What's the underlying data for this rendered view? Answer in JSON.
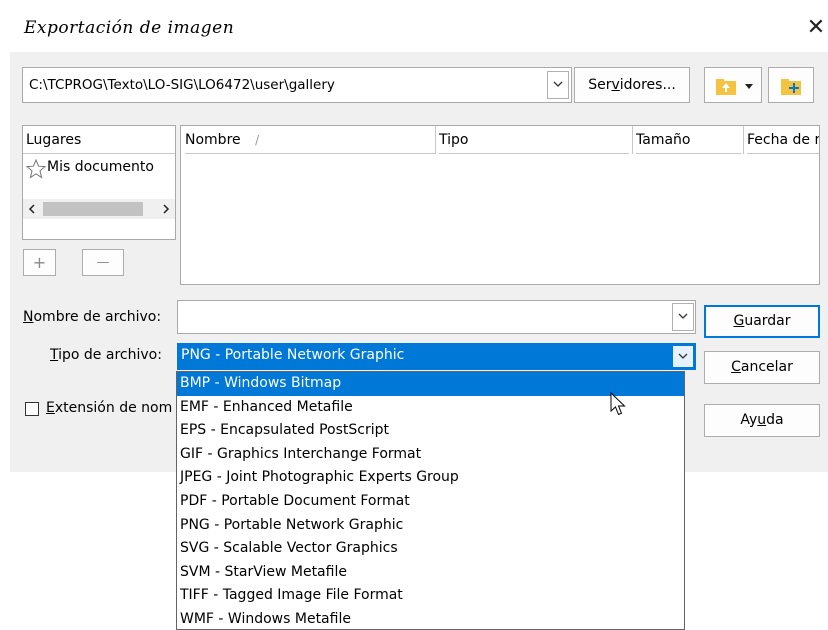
{
  "window": {
    "title": "Exportación de imagen",
    "close_glyph": "✕"
  },
  "toolbar": {
    "path_value": "C:\\TCPROG\\Texto\\LO-SIG\\LO6472\\user\\gallery",
    "servers_label_pre": "Ser",
    "servers_label_key": "v",
    "servers_label_post": "idores...",
    "up_folder_icon": "folder-up-icon",
    "new_folder_icon": "new-folder-icon",
    "folder_color": "#f5c342",
    "accent_color": "#0078d7"
  },
  "places": {
    "header": "Lugares",
    "items": [
      {
        "label": "Mis documento",
        "icon": "star-icon"
      }
    ],
    "add_label": "+",
    "remove_label": "—"
  },
  "files": {
    "columns": [
      "Nombre",
      "Tipo",
      "Tamaño",
      "Fecha de r"
    ],
    "sort_glyph": "/"
  },
  "form": {
    "filename_label_key": "N",
    "filename_label_post": "ombre de archivo:",
    "filename_value": "",
    "filetype_label_key": "T",
    "filetype_label_post": "ipo de archivo:",
    "filetype_value": "PNG - Portable Network Graphic",
    "extension_label_key": "E",
    "extension_label_post": "xtensión de nom",
    "extension_checked": false
  },
  "buttons": {
    "save_key": "G",
    "save_post": "uardar",
    "cancel_key": "C",
    "cancel_post": "ancelar",
    "help_pre": "Ay",
    "help_key": "u",
    "help_post": "da"
  },
  "filetype_options": [
    "BMP - Windows Bitmap",
    "EMF - Enhanced Metafile",
    "EPS - Encapsulated PostScript",
    "GIF - Graphics Interchange Format",
    "JPEG - Joint Photographic Experts Group",
    "PDF - Portable Document Format",
    "PNG - Portable Network Graphic",
    "SVG - Scalable Vector Graphics",
    "SVM - StarView Metafile",
    "TIFF - Tagged Image File Format",
    "WMF - Windows Metafile"
  ],
  "highlighted_option_index": 0
}
